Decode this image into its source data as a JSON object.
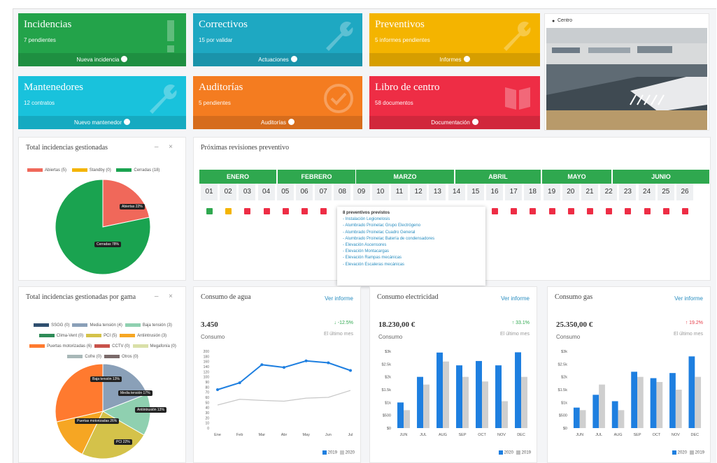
{
  "tiles": [
    {
      "title": "Incidencias",
      "sub": "7 pendientes",
      "footer": "Nueva incidencia",
      "color": "#23a34a",
      "icon": "exclamation-icon"
    },
    {
      "title": "Correctivos",
      "sub": "15 por validar",
      "footer": "Actuaciones",
      "color": "#1ea8c2",
      "icon": "wrench-icon"
    },
    {
      "title": "Preventivos",
      "sub": "5 informes pendientes",
      "footer": "Informes",
      "color": "#f4b400",
      "icon": "wrench-icon"
    },
    {
      "title": "Mantenedores",
      "sub": "12 contratos",
      "footer": "Nuevo mantenedor",
      "color": "#19c2dc",
      "icon": "wrench-icon"
    },
    {
      "title": "Auditorías",
      "sub": "5 pendientes",
      "footer": "Auditorías",
      "color": "#f47c20",
      "icon": "check-badge-icon"
    },
    {
      "title": "Libro de centro",
      "sub": "58 documentos",
      "footer": "Documentación",
      "color": "#ee2d45",
      "icon": "book-icon"
    }
  ],
  "centro": {
    "label": "Centro"
  },
  "incidencias_card": {
    "title": "Total incidencias gestionadas",
    "legend": [
      "Abiertas (5)",
      "Standby (0)",
      "Cerradas (18)"
    ],
    "tags": [
      "Abiertas 22%",
      "Cerradas 78%"
    ]
  },
  "preventivo": {
    "title": "Próximas revisiones preventivo",
    "months": [
      "ENERO",
      "FEBRERO",
      "MARZO",
      "ABRIL",
      "MAYO",
      "JUNIO"
    ],
    "days": [
      "01",
      "02",
      "03",
      "04",
      "05",
      "06",
      "07",
      "08",
      "09",
      "10",
      "11",
      "12",
      "13",
      "14",
      "15",
      "16",
      "17",
      "18",
      "19",
      "20",
      "21",
      "22",
      "23",
      "24",
      "25",
      "26"
    ],
    "popup_title": "8 preventivos previstos",
    "popup_items": [
      "- Instalación Legionelosis",
      "- Alumbrado Proinelac Grupo Electrógeno",
      "- Alumbrado Proinelac Cuadro General",
      "- Alumbrado Proinelac Batería de condensadores",
      "- Elevación Ascensores",
      "- Elevación Montacargas",
      "- Elevación Rampas mecánicas",
      "- Elevación Escaleras mecánicas"
    ]
  },
  "gama_card": {
    "title": "Total incidencias gestionadas por gama",
    "legend": [
      [
        "SSGG (0)",
        "#2f4f6f"
      ],
      [
        "Media tensión (4)",
        "#8aa0b8"
      ],
      [
        "Baja tensión (3)",
        "#8fd0b0"
      ],
      [
        "Clima-Vent (0)",
        "#2e8b57"
      ],
      [
        "PCI (5)",
        "#d4c24a"
      ],
      [
        "Antiintrusión (3)",
        "#f6a623"
      ],
      [
        "Puertas motorizadas (6)",
        "#ff7a2f"
      ],
      [
        "CCTV (0)",
        "#c8524a"
      ],
      [
        "Megafonía (0)",
        "#d9e0a8"
      ],
      [
        "Cofre (0)",
        "#a8b8b8"
      ],
      [
        "Otros (0)",
        "#7a6a6a"
      ]
    ],
    "tags": [
      "Baja tensión 13%",
      "Media tensión 17%",
      "Antiintrusión 13%",
      "Puertas motorizadas 26%",
      "PCI 22%"
    ]
  },
  "agua": {
    "title": "Consumo de agua",
    "link": "Ver informe",
    "value": "3.450",
    "label": "Consumo",
    "delta": "-12.5%",
    "period": "El último mes",
    "legend": [
      "2019",
      "2020"
    ]
  },
  "elec": {
    "title": "Consumo electricidad",
    "link": "Ver informe",
    "value": "18.230,00 €",
    "label": "Consumo",
    "delta": "33.1%",
    "period": "El último mes",
    "legend": [
      "2020",
      "2019"
    ]
  },
  "gas": {
    "title": "Consumo gas",
    "link": "Ver informe",
    "value": "25.350,00 €",
    "label": "Consumo",
    "delta": "19.2%",
    "period": "El último mes",
    "legend": [
      "2020",
      "2019"
    ]
  },
  "chart_data": [
    {
      "type": "pie",
      "title": "Total incidencias gestionadas",
      "categories": [
        "Abiertas",
        "Standby",
        "Cerradas"
      ],
      "values": [
        5,
        0,
        18
      ]
    },
    {
      "type": "pie",
      "title": "Total incidencias gestionadas por gama",
      "categories": [
        "SSGG",
        "Media tensión",
        "Baja tensión",
        "Clima-Vent",
        "PCI",
        "Antiintrusión",
        "Puertas motorizadas",
        "CCTV",
        "Megafonía",
        "Cofre",
        "Otros"
      ],
      "values": [
        0,
        4,
        3,
        0,
        5,
        3,
        6,
        0,
        0,
        0,
        0
      ]
    },
    {
      "type": "line",
      "title": "Consumo de agua",
      "categories": [
        "Ene",
        "Feb",
        "Mar",
        "Abr",
        "May",
        "Jun",
        "Jul"
      ],
      "ylim": [
        0,
        200
      ],
      "yticks": [
        "0",
        "10",
        "20",
        "30",
        "40",
        "50",
        "60",
        "70",
        "80",
        "90",
        "100",
        "120",
        "140",
        "160",
        "180",
        "200"
      ],
      "series": [
        {
          "name": "2019",
          "color": "#1e7fe0",
          "values": [
            100,
            118,
            165,
            158,
            175,
            170,
            150
          ]
        },
        {
          "name": "2020",
          "color": "#c8c8c8",
          "values": [
            60,
            75,
            72,
            70,
            78,
            80,
            98
          ]
        }
      ]
    },
    {
      "type": "bar",
      "title": "Consumo electricidad",
      "categories": [
        "JUN",
        "JUL",
        "AUG",
        "SEP",
        "OCT",
        "NOV",
        "DEC"
      ],
      "ylim": [
        0,
        3000
      ],
      "yticks": [
        "$0",
        "$500",
        "$1k",
        "$1.5k",
        "$2k",
        "$2.5k",
        "$3k"
      ],
      "series": [
        {
          "name": "2020",
          "color": "#1e7fe0",
          "values": [
            1000,
            2000,
            2950,
            2450,
            2620,
            2450,
            2960
          ]
        },
        {
          "name": "2019",
          "color": "#cfcfcf",
          "values": [
            700,
            1700,
            2600,
            2000,
            1820,
            1050,
            2000
          ]
        }
      ]
    },
    {
      "type": "bar",
      "title": "Consumo gas",
      "categories": [
        "JUN",
        "JUL",
        "AUG",
        "SEP",
        "OCT",
        "NOV",
        "DEC"
      ],
      "ylim": [
        0,
        3000
      ],
      "yticks": [
        "$0",
        "$500",
        "$1k",
        "$1.5k",
        "$2k",
        "$2.5k",
        "$3k"
      ],
      "series": [
        {
          "name": "2020",
          "color": "#1e7fe0",
          "values": [
            800,
            1300,
            1050,
            2200,
            1950,
            2150,
            2800
          ]
        },
        {
          "name": "2019",
          "color": "#cfcfcf",
          "values": [
            700,
            1700,
            700,
            2000,
            1800,
            1500,
            2000
          ]
        }
      ]
    }
  ]
}
